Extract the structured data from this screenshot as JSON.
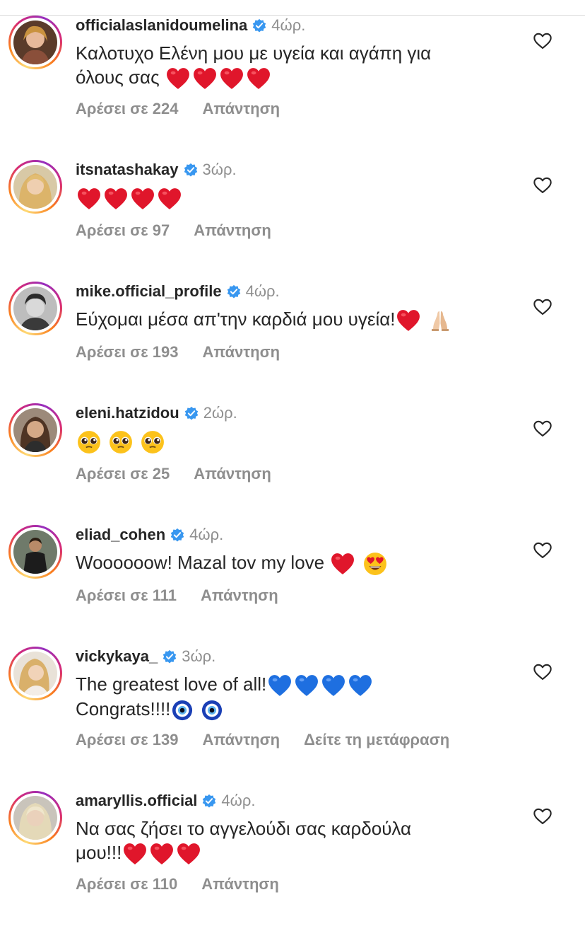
{
  "colors": {
    "text": "#262626",
    "muted": "#8e8e8e",
    "verified": "#3897f0",
    "heart": "#e0162b",
    "blue_heart": "#1e6fe0"
  },
  "comments": [
    {
      "username": "officialaslanidoumelina",
      "time": "4ώρ.",
      "text": "Καλοτυχο Ελένη μου με υγεία και αγάπη για",
      "text2": "όλους σας",
      "likes": "Αρέσει σε 224",
      "reply": "Απάντηση"
    },
    {
      "username": "itsnatashakay",
      "time": "3ώρ.",
      "text": "",
      "likes": "Αρέσει σε 97",
      "reply": "Απάντηση"
    },
    {
      "username": "mike.official_profile",
      "time": "4ώρ.",
      "text": "Εύχομαι μέσα απ'την καρδιά μου υγεία!",
      "likes": "Αρέσει σε 193",
      "reply": "Απάντηση"
    },
    {
      "username": "eleni.hatzidou",
      "time": "2ώρ.",
      "text": "",
      "likes": "Αρέσει σε 25",
      "reply": "Απάντηση"
    },
    {
      "username": "eliad_cohen",
      "time": "4ώρ.",
      "text": "Woooooow! Mazal tov my love",
      "likes": "Αρέσει σε 111",
      "reply": "Απάντηση"
    },
    {
      "username": "vickykaya_",
      "time": "3ώρ.",
      "text": "The greatest love of all!",
      "text2": "Congrats!!!!",
      "likes": "Αρέσει σε 139",
      "reply": "Απάντηση",
      "translate": "Δείτε τη μετάφραση"
    },
    {
      "username": "amaryllis.official",
      "time": "4ώρ.",
      "text": "Να σας ζήσει το αγγελούδι σας καρδούλα",
      "text2": "μου!!!",
      "likes": "Αρέσει σε 110",
      "reply": "Απάντηση"
    }
  ],
  "icons": {
    "verified": "verified-badge-icon",
    "like": "heart-outline-icon"
  }
}
